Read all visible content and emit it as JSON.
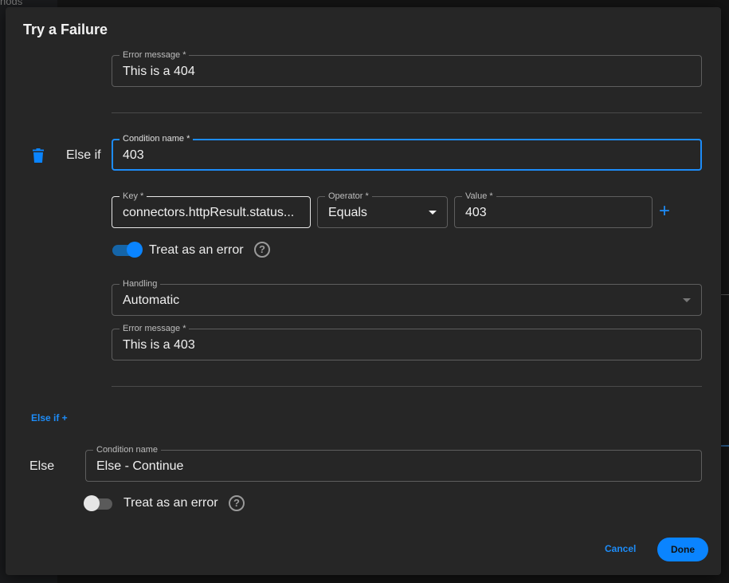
{
  "background": {
    "partial_text": "hods"
  },
  "dialog": {
    "title": "Try a Failure",
    "prev_condition": {
      "error_message": {
        "label": "Error message *",
        "value": "This is a 404"
      }
    },
    "else_if": {
      "row_label": "Else if",
      "condition_name": {
        "label": "Condition name *",
        "value": "403"
      },
      "key": {
        "label": "Key *",
        "value": "connectors.httpResult.status..."
      },
      "operator": {
        "label": "Operator *",
        "value": "Equals"
      },
      "value": {
        "label": "Value *",
        "value": "403"
      },
      "treat_as_error": {
        "label": "Treat as an error",
        "checked": true
      },
      "handling": {
        "label": "Handling",
        "value": "Automatic"
      },
      "error_message": {
        "label": "Error message *",
        "value": "This is a 403"
      }
    },
    "add_else_if_label": "Else if +",
    "else": {
      "row_label": "Else",
      "condition_name": {
        "label": "Condition name",
        "value": "Else - Continue"
      },
      "treat_as_error": {
        "label": "Treat as an error",
        "checked": false
      }
    },
    "help_glyph": "?",
    "plus_glyph": "+",
    "actions": {
      "cancel": "Cancel",
      "done": "Done"
    }
  },
  "colors": {
    "accent": "#0a84ff",
    "surface": "#262626",
    "border": "#5e5e5e"
  }
}
